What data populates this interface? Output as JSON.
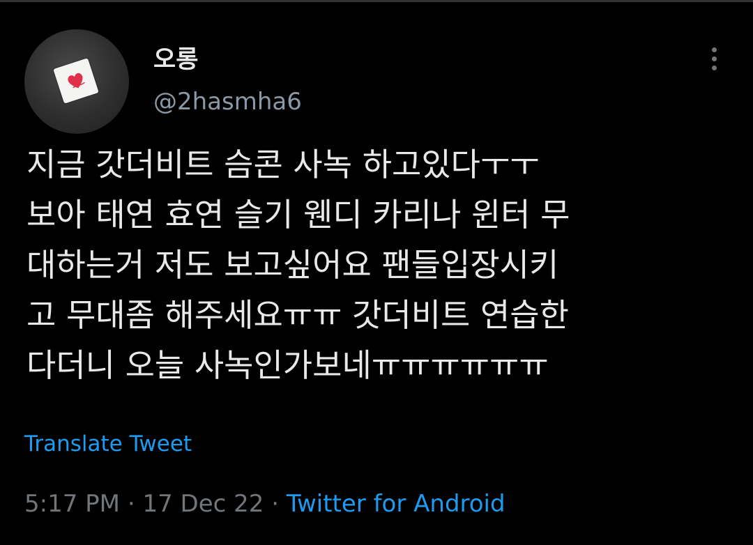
{
  "tweet": {
    "author": {
      "display_name": "오롱",
      "handle": "@2hasmha6",
      "avatar": "heart-card-avatar"
    },
    "text_lines": [
      "지금 갓더비트 슴콘 사녹 하고있다ㅜㅜ",
      "보아 태연 효연 슬기 웬디 카리나 윈터 무",
      "대하는거 저도 보고싶어요 팬들입장시키",
      "고 무대좀 해주세요ㅠㅠ 갓더비트 연습한",
      "다더니 오늘 사녹인가보네ㅠㅠㅠㅠㅠㅠ"
    ],
    "translate_label": "Translate Tweet",
    "time": "5:17 PM",
    "separator": "·",
    "date": "17 Dec 22",
    "source": "Twitter for Android"
  },
  "icons": {
    "more": "more-vertical-icon"
  },
  "colors": {
    "background": "#000000",
    "text": "#e7e9ea",
    "secondary": "#71767b",
    "link": "#1d9bf0"
  }
}
